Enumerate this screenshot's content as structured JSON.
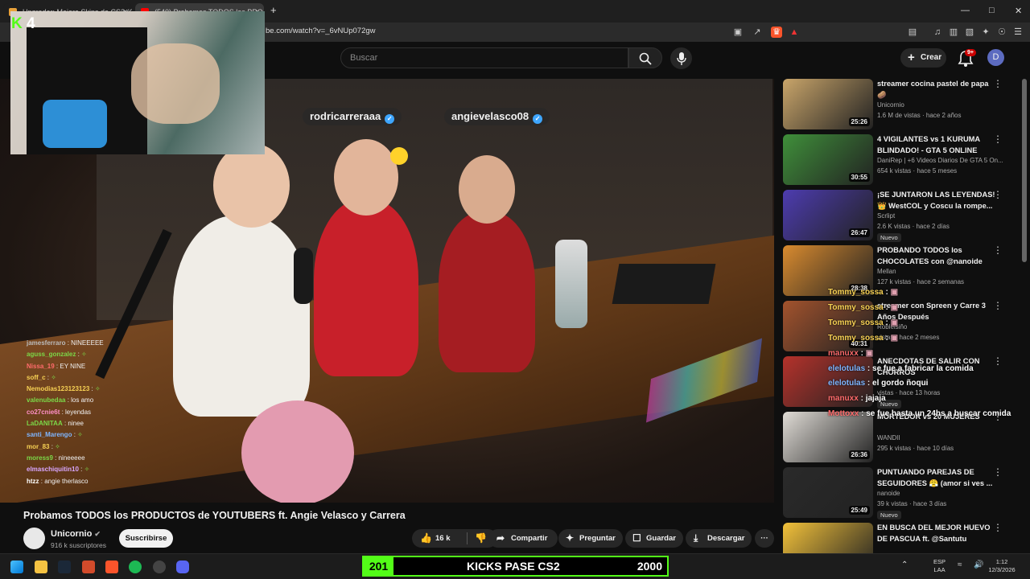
{
  "browser": {
    "tabs": [
      {
        "title": "Upgrader: Mejora Skins de CS2 (CS:G",
        "close": "×",
        "color": "#e9a23b"
      },
      {
        "title": "(540) Probamos TODOS los PRO",
        "close": "×",
        "color": "#ff0000"
      }
    ],
    "new_tab": "+",
    "url": "be.com/watch?v=_6vNUp072gw"
  },
  "youtube": {
    "search_placeholder": "Buscar",
    "create_label": "Crear",
    "notif_badge": "9+",
    "avatar_letter": "D"
  },
  "overlay": {
    "kick_logo": "K",
    "kick_count": "4",
    "tags": [
      "rodricarreraaa",
      "angievelasco08"
    ],
    "chat": [
      {
        "user": "jamesferraro",
        "msg": "NINEEEEE",
        "color": "#bbbbbb"
      },
      {
        "user": "aguss_gonzalez",
        "msg": "",
        "color": "#7cd848"
      },
      {
        "user": "Nissa_19",
        "msg": "EY NINE",
        "color": "#ff6b6b"
      },
      {
        "user": "soff_c",
        "msg": "",
        "color": "#f7d154"
      },
      {
        "user": "Nemodias123123123",
        "msg": "",
        "color": "#f7d154"
      },
      {
        "user": "valenubedaa",
        "msg": "los amo",
        "color": "#7cd848"
      },
      {
        "user": "co27cnie6t",
        "msg": "leyendas",
        "color": "#ff8fc7"
      },
      {
        "user": "LaDANITAA",
        "msg": "ninee",
        "color": "#7cd848"
      },
      {
        "user": "santi_Marengo",
        "msg": "",
        "color": "#7fb6ff"
      },
      {
        "user": "mor_83",
        "msg": "",
        "color": "#f7d154"
      },
      {
        "user": "moress9",
        "msg": "nineeeee",
        "color": "#7cd848"
      },
      {
        "user": "elmaschiquitin10",
        "msg": "",
        "color": "#d9a6ff"
      },
      {
        "user": "htzz",
        "msg": "angie therlasco",
        "color": "#ffffff"
      }
    ],
    "comments": [
      {
        "user": "Tommy_sossa",
        "msg": "",
        "color": "#f7d154"
      },
      {
        "user": "Tommy_sossa",
        "msg": "",
        "color": "#f7d154"
      },
      {
        "user": "Tommy_sossa",
        "msg": "",
        "color": "#f7d154"
      },
      {
        "user": "Tommy_sossa",
        "msg": "",
        "color": "#f7d154"
      },
      {
        "user": "manuxx",
        "msg": "",
        "color": "#ff6b6b"
      },
      {
        "user": "elelotulas",
        "msg": "se fue a fabricar la comida",
        "color": "#7fb6ff"
      },
      {
        "user": "elelotulas",
        "msg": "el gordo ñoqui",
        "color": "#7fb6ff"
      },
      {
        "user": "manuxx",
        "msg": "jajaja",
        "color": "#ff6b6b"
      },
      {
        "user": "Mottoxx",
        "msg": "se fue hasta un 24hs a buscar comida",
        "color": "#ff6b6b"
      }
    ]
  },
  "video": {
    "title": "Probamos TODOS los PRODUCTOS de YOUTUBERS ft. Angie Velasco y Carrera",
    "channel": "Unicornio",
    "subscribers": "916 k suscriptores",
    "subscribe_label": "Suscribirse",
    "likes": "16 k",
    "share_label": "Compartir",
    "ask_label": "Preguntar",
    "save_label": "Guardar",
    "download_label": "Descargar",
    "more_label": "···"
  },
  "sidebar": {
    "items": [
      {
        "title": "streamer cocina pastel de papa 🥔",
        "channel": "Unicornio",
        "meta": "1.6 M de vistas · hace 2 años",
        "duration": "25:26",
        "nuevo": "",
        "thumb": "#c9a56a"
      },
      {
        "title": "4 VIGILANTES vs 1 KURUMA BLINDADO! - GTA 5 ONLINE",
        "channel": "DaniRep | +6 Videos Diarios De GTA 5 On...",
        "meta": "654 k vistas · hace 5 meses",
        "duration": "30:55",
        "nuevo": "",
        "thumb": "#3f8f3a"
      },
      {
        "title": "¡SE JUNTARON LAS LEYENDAS! 👑 WestCOL y Coscu la rompe...",
        "channel": "Scrlipt",
        "meta": "2.6 K vistas · hace 2 días",
        "duration": "26:47",
        "nuevo": "Nuevo",
        "thumb": "#4d3cb0"
      },
      {
        "title": "PROBANDO TODOS los CHOCOLATES con @nanoide",
        "channel": "Mellan",
        "meta": "127 k vistas · hace 2 semanas",
        "duration": "28:38",
        "nuevo": "",
        "thumb": "#d98b2f"
      },
      {
        "title": "streamer con Spreen y Carre 3 Años Después",
        "channel": "Robleisiño",
        "meta": "vistas · hace 2 meses",
        "duration": "40:31",
        "nuevo": "",
        "thumb": "#a3532d"
      },
      {
        "title": "ANECDOTAS DE SALIR CON CHORROS",
        "channel": "",
        "meta": "vistas · hace 13 horas",
        "duration": "",
        "nuevo": "Nuevo",
        "thumb": "#b5322b"
      },
      {
        "title": "MORTEDOR vs 20 MUJERES",
        "channel": "WANDII",
        "meta": "295 k vistas · hace 10 días",
        "duration": "26:36",
        "nuevo": "",
        "thumb": "#e0dcd6"
      },
      {
        "title": "PUNTUANDO PAREJAS DE SEGUIDORES 😤 (amor si ves ...",
        "channel": "nanoide",
        "meta": "39 k vistas · hace 3 días",
        "duration": "25:49",
        "nuevo": "Nuevo",
        "thumb": "#2a2a2a"
      },
      {
        "title": "EN BUSCA DEL MEJOR HUEVO DE PASCUA ft. @Santutu",
        "channel": "",
        "meta": "",
        "duration": "",
        "nuevo": "",
        "thumb": "#f2c13a"
      }
    ]
  },
  "taskbar": {
    "kicks_left": "201",
    "kicks_title": "KICKS PASE CS2",
    "kicks_right": "2000",
    "lang_top": "ESP",
    "lang_bottom": "LAA",
    "time": "1:12",
    "date": "12/3/2026"
  },
  "colors": {
    "kick_green": "#53fc18",
    "youtube_red": "#ff0000",
    "accent_blue": "#3ea6ff"
  }
}
